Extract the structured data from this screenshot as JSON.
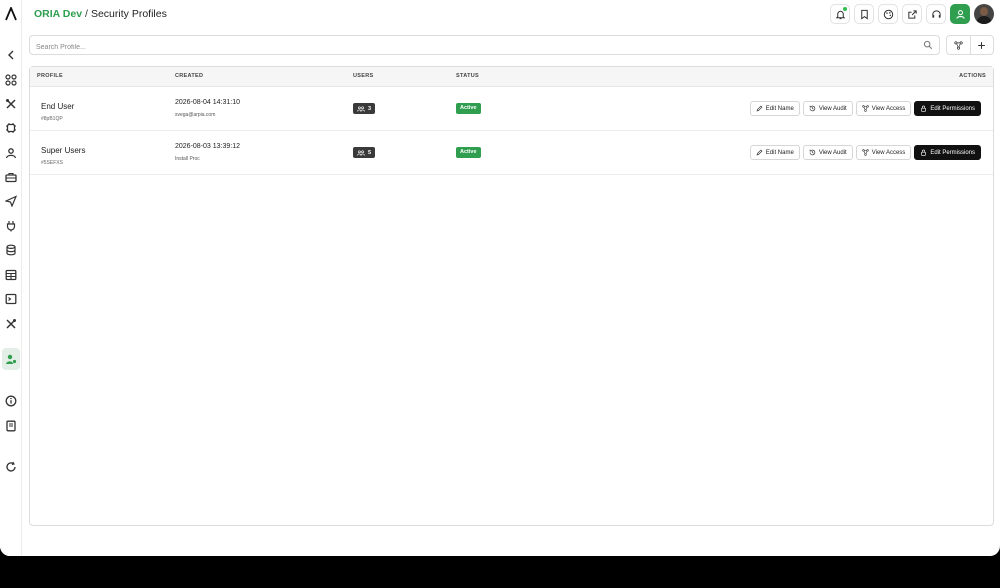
{
  "header": {
    "org": "ORIA Dev",
    "separator": "/",
    "page_title": "Security Profiles"
  },
  "sidebar": {
    "items": [
      {
        "icon": "chevron-left-icon"
      },
      {
        "icon": "grid-icon"
      },
      {
        "icon": "tools-icon"
      },
      {
        "icon": "chip-icon"
      },
      {
        "icon": "users-icon"
      },
      {
        "icon": "toolbox-icon"
      },
      {
        "icon": "send-icon"
      },
      {
        "icon": "plug-icon"
      },
      {
        "icon": "database-icon"
      },
      {
        "icon": "table-icon"
      },
      {
        "icon": "terminal-icon"
      },
      {
        "icon": "wrench-icon"
      },
      {
        "icon": "user-shield-icon",
        "active": true
      },
      {
        "icon": "info-icon"
      },
      {
        "icon": "book-icon"
      },
      {
        "icon": "refresh-icon"
      }
    ]
  },
  "search": {
    "placeholder": "Search Profile..."
  },
  "table": {
    "headers": {
      "profile": "PROFILE",
      "created": "CREATED",
      "users": "USERS",
      "status": "STATUS",
      "actions": "ACTIONS"
    },
    "rows": [
      {
        "name": "End User",
        "id": "#8pB1QP",
        "created_at": "2026-08-04 14:31:10",
        "created_by": "svega@arpia.com",
        "users": "3",
        "status": "Active"
      },
      {
        "name": "Super Users",
        "id": "#5SEFXS",
        "created_at": "2026-08-03 13:39:12",
        "created_by": "Install Proc",
        "users": "5",
        "status": "Active"
      }
    ],
    "actions": {
      "edit_name": "Edit Name",
      "view_audit": "View Audit",
      "view_access": "View Access",
      "edit_permissions": "Edit Permissions"
    }
  },
  "colors": {
    "brand": "#2f9e4f",
    "dark_button": "#111111",
    "badge_dark": "#3a3a3a"
  }
}
